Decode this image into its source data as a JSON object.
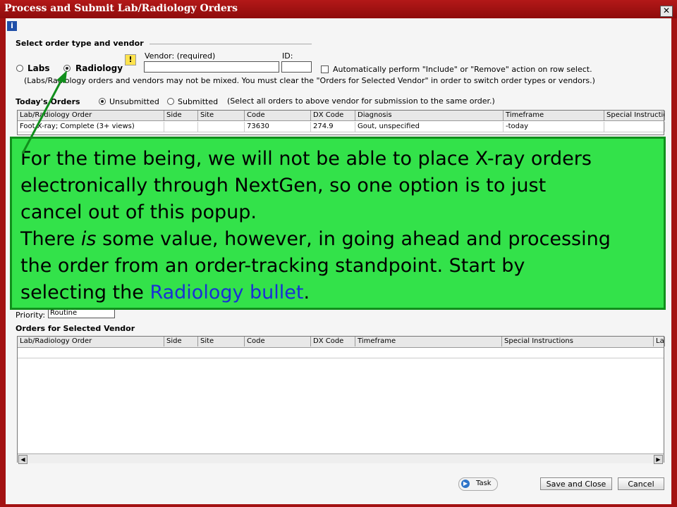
{
  "window": {
    "title": "Process and Submit Lab/Radiology Orders",
    "close": "✕"
  },
  "info_icon": "i",
  "select_section": {
    "label": "Select order type and vendor",
    "labs": "Labs",
    "radiology": "Radiology",
    "vendor_label": "Vendor: (required)",
    "id_label": "ID:",
    "auto_checkbox": "Automatically perform \"Include\" or \"Remove\" action on row select.",
    "note": "(Labs/Radiology orders and vendors may not be mixed. You must clear the \"Orders for Selected Vendor\" in order to switch order types or vendors.)"
  },
  "todays_orders": {
    "label": "Today's Orders",
    "unsubmitted": "Unsubmitted",
    "submitted": "Submitted",
    "hint": "(Select all orders to above vendor for submission to the same order.)",
    "columns": [
      "Lab/Radiology Order",
      "Side",
      "Site",
      "Code",
      "DX Code",
      "Diagnosis",
      "Timeframe",
      "Special Instruction"
    ],
    "rows": [
      [
        "Foot X-ray; Complete (3+ views)",
        "",
        "",
        "73630",
        "274.9",
        "Gout, unspecified",
        "-today",
        ""
      ]
    ]
  },
  "priority": {
    "label": "Priority:",
    "value": "Routine"
  },
  "vendor_orders": {
    "label": "Orders for Selected Vendor",
    "columns": [
      "Lab/Radiology Order",
      "Side",
      "Site",
      "Code",
      "DX Code",
      "Timeframe",
      "Special Instructions",
      "La"
    ]
  },
  "footer": {
    "task": "Task",
    "save_close": "Save and Close",
    "cancel": "Cancel"
  },
  "callout": {
    "line1": "For the time being, we will not be able to place X-ray orders",
    "line2": "electronically through NextGen, so one option is to just",
    "line3": "cancel out of this popup.",
    "line4_a": "There ",
    "line4_b": "is",
    "line4_c": " some value, however, in going ahead and processing",
    "line5": "the order from an order-tracking standpoint.  Start by",
    "line6_a": "selecting the ",
    "line6_b": "Radiology bullet",
    "line6_c": "."
  },
  "colors": {
    "titlebar": "#a31212",
    "callout_bg": "#33e24a",
    "callout_border": "#118f1c",
    "highlight_text": "#1a2fd6"
  },
  "icons": [
    "close-icon",
    "info-icon",
    "warning-icon",
    "task-icon",
    "scroll-left-icon",
    "scroll-right-icon"
  ]
}
